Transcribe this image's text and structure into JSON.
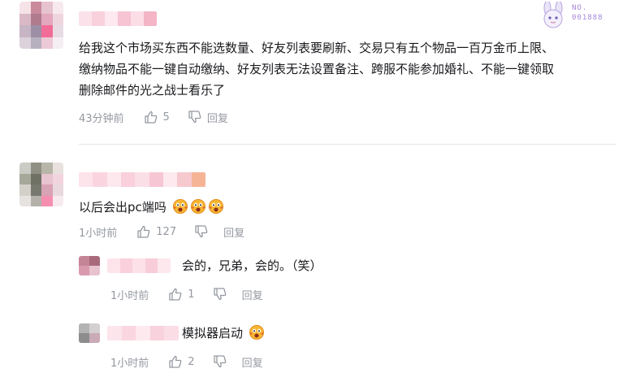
{
  "comments": [
    {
      "text_lines": [
        "给我这个市场买东西不能选数量、好友列表要刷新、交易只有五个物品一百万金币上限、",
        "缴纳物品不能一键自动缴纳、好友列表无法设置备注、跨服不能参加婚礼、不能一键领取",
        "删除邮件的光之战士看乐了"
      ],
      "time": "43分钟前",
      "likes": "5",
      "reply_label": "回复",
      "badge": "NO.\n001888",
      "badge_line1": "NO.",
      "badge_line2": "001888"
    },
    {
      "text": "以后会出pc端吗",
      "time": "1小时前",
      "likes": "127",
      "reply_label": "回复",
      "replies": [
        {
          "text": "会的，兄弟，会的。（笑）",
          "time": "1小时前",
          "likes": "1",
          "reply_label": "回复"
        },
        {
          "text": "模拟器启动",
          "time": "1小时前",
          "likes": "2",
          "reply_label": "回复"
        }
      ]
    }
  ],
  "colors": {
    "meta": "#9499a0",
    "text": "#18191c",
    "divider": "#e3e5e7",
    "badge": "#a387d8"
  }
}
